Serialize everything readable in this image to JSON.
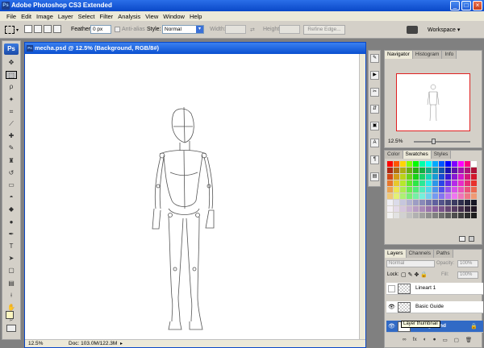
{
  "app": {
    "title": "Adobe Photoshop CS3 Extended",
    "icon_label": "Ps",
    "window_buttons": [
      "_",
      "□",
      "×"
    ]
  },
  "menu": [
    "File",
    "Edit",
    "Image",
    "Layer",
    "Select",
    "Filter",
    "Analysis",
    "View",
    "Window",
    "Help"
  ],
  "options_bar": {
    "feather_label": "Feather:",
    "feather_value": "0 px",
    "antialias_label": "Anti-alias",
    "style_label": "Style:",
    "style_value": "Normal",
    "width_label": "Width:",
    "height_label": "Height:",
    "refine_edge": "Refine Edge...",
    "workspace": "Workspace ▾"
  },
  "toolbox": {
    "logo": "Ps",
    "tools": [
      {
        "name": "move-tool",
        "glyph": "✥"
      },
      {
        "name": "marquee-tool",
        "glyph": "⬚",
        "selected": true
      },
      {
        "name": "lasso-tool",
        "glyph": "ρ"
      },
      {
        "name": "magic-wand-tool",
        "glyph": "✦"
      },
      {
        "name": "crop-tool",
        "glyph": "⌗"
      },
      {
        "name": "slice-tool",
        "glyph": "⟋"
      },
      {
        "name": "healing-tool",
        "glyph": "✚"
      },
      {
        "name": "brush-tool",
        "glyph": "✎"
      },
      {
        "name": "stamp-tool",
        "glyph": "♜"
      },
      {
        "name": "history-brush-tool",
        "glyph": "↺"
      },
      {
        "name": "eraser-tool",
        "glyph": "▭"
      },
      {
        "name": "bucket-tool",
        "glyph": "◓"
      },
      {
        "name": "blur-tool",
        "glyph": "◆"
      },
      {
        "name": "dodge-tool",
        "glyph": "●"
      },
      {
        "name": "pen-tool",
        "glyph": "✒"
      },
      {
        "name": "type-tool",
        "glyph": "T"
      },
      {
        "name": "path-select-tool",
        "glyph": "➤"
      },
      {
        "name": "shape-tool",
        "glyph": "▢"
      },
      {
        "name": "notes-tool",
        "glyph": "▤"
      },
      {
        "name": "eyedropper-tool",
        "glyph": "⟊"
      },
      {
        "name": "hand-tool",
        "glyph": "✋"
      },
      {
        "name": "zoom-tool",
        "glyph": "⌕"
      }
    ],
    "foreground_color": "#fbf5c0"
  },
  "document": {
    "title": "mecha.psd @ 12.5% (Background, RGB/8#)",
    "icon_label": "Ps",
    "zoom": "12.5%",
    "doc_size": "Doc: 103.0M/122.3M"
  },
  "panel_strip_icons": [
    "brush-icon",
    "action-icon",
    "tools-icon",
    "clone-icon",
    "layer-comps-icon",
    "char-icon",
    "para-icon",
    "info-icon"
  ],
  "navigator": {
    "tabs": [
      "Navigator",
      "Histogram",
      "Info"
    ],
    "zoom": "12.5%",
    "view_box_color": "#e02020"
  },
  "color_panel": {
    "tabs": [
      "Color",
      "Swatches",
      "Styles"
    ]
  },
  "layers": {
    "tabs": [
      "Layers",
      "Channels",
      "Paths"
    ],
    "blend_mode": "Normal",
    "opacity_label": "Opacity:",
    "opacity_value": "100%",
    "lock_label": "Lock:",
    "fill_label": "Fill:",
    "fill_value": "100%",
    "rows": [
      {
        "name": "Lineart 1",
        "visible": false
      },
      {
        "name": "Basic Guide",
        "visible": true
      },
      {
        "name": "Background",
        "visible": true,
        "selected": true
      }
    ],
    "tooltip": "Layer thumbnail"
  }
}
